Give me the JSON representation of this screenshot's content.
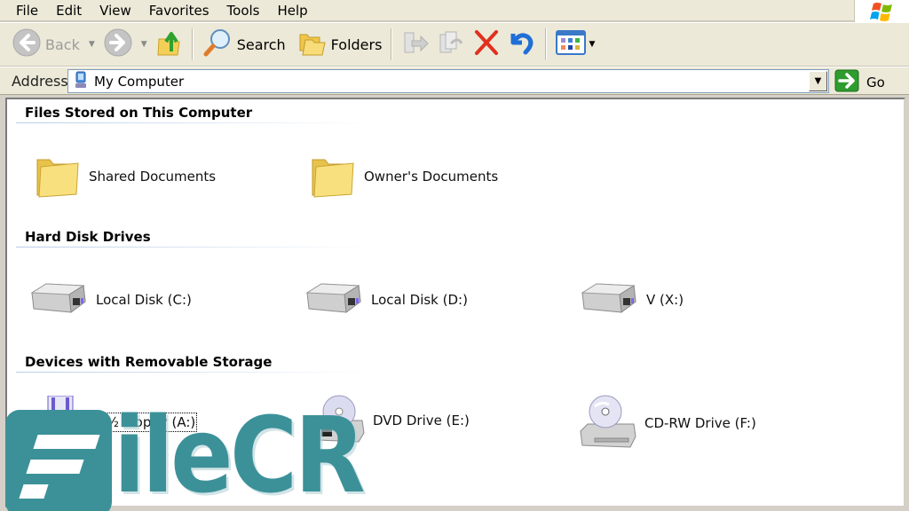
{
  "menu": {
    "items": [
      "File",
      "Edit",
      "View",
      "Favorites",
      "Tools",
      "Help"
    ]
  },
  "toolbar": {
    "back_label": "Back",
    "search_label": "Search",
    "folders_label": "Folders",
    "icons": [
      "back-icon",
      "forward-icon",
      "up-folder-icon",
      "search-icon",
      "folders-icon",
      "move-to-icon",
      "copy-to-icon",
      "delete-icon",
      "undo-icon",
      "views-icon"
    ]
  },
  "address": {
    "label": "Address",
    "value": "My Computer",
    "go_label": "Go"
  },
  "groups": [
    {
      "title": "Files Stored on This Computer",
      "items": [
        {
          "label": "Shared Documents",
          "icon": "folder-icon"
        },
        {
          "label": "Owner's Documents",
          "icon": "folder-icon"
        }
      ]
    },
    {
      "title": "Hard Disk Drives",
      "items": [
        {
          "label": "Local Disk (C:)",
          "icon": "hard-disk-icon"
        },
        {
          "label": "Local Disk (D:)",
          "icon": "hard-disk-icon"
        },
        {
          "label": "V (X:)",
          "icon": "hard-disk-icon"
        }
      ]
    },
    {
      "title": "Devices with Removable Storage",
      "items": [
        {
          "label": "3½ Floppy (A:)",
          "icon": "floppy-drive-icon"
        },
        {
          "label": "DVD Drive (E:)",
          "icon": "dvd-drive-icon"
        },
        {
          "label": "CD-RW Drive (F:)",
          "icon": "cd-drive-icon"
        }
      ]
    }
  ],
  "watermark": {
    "text": "ileCR",
    "color": "#3c9199"
  },
  "colors": {
    "chrome": "#ece9d8",
    "accent_go": "#2e9c2e",
    "delete_red": "#e0301e",
    "undo_blue": "#1f6fd6"
  }
}
